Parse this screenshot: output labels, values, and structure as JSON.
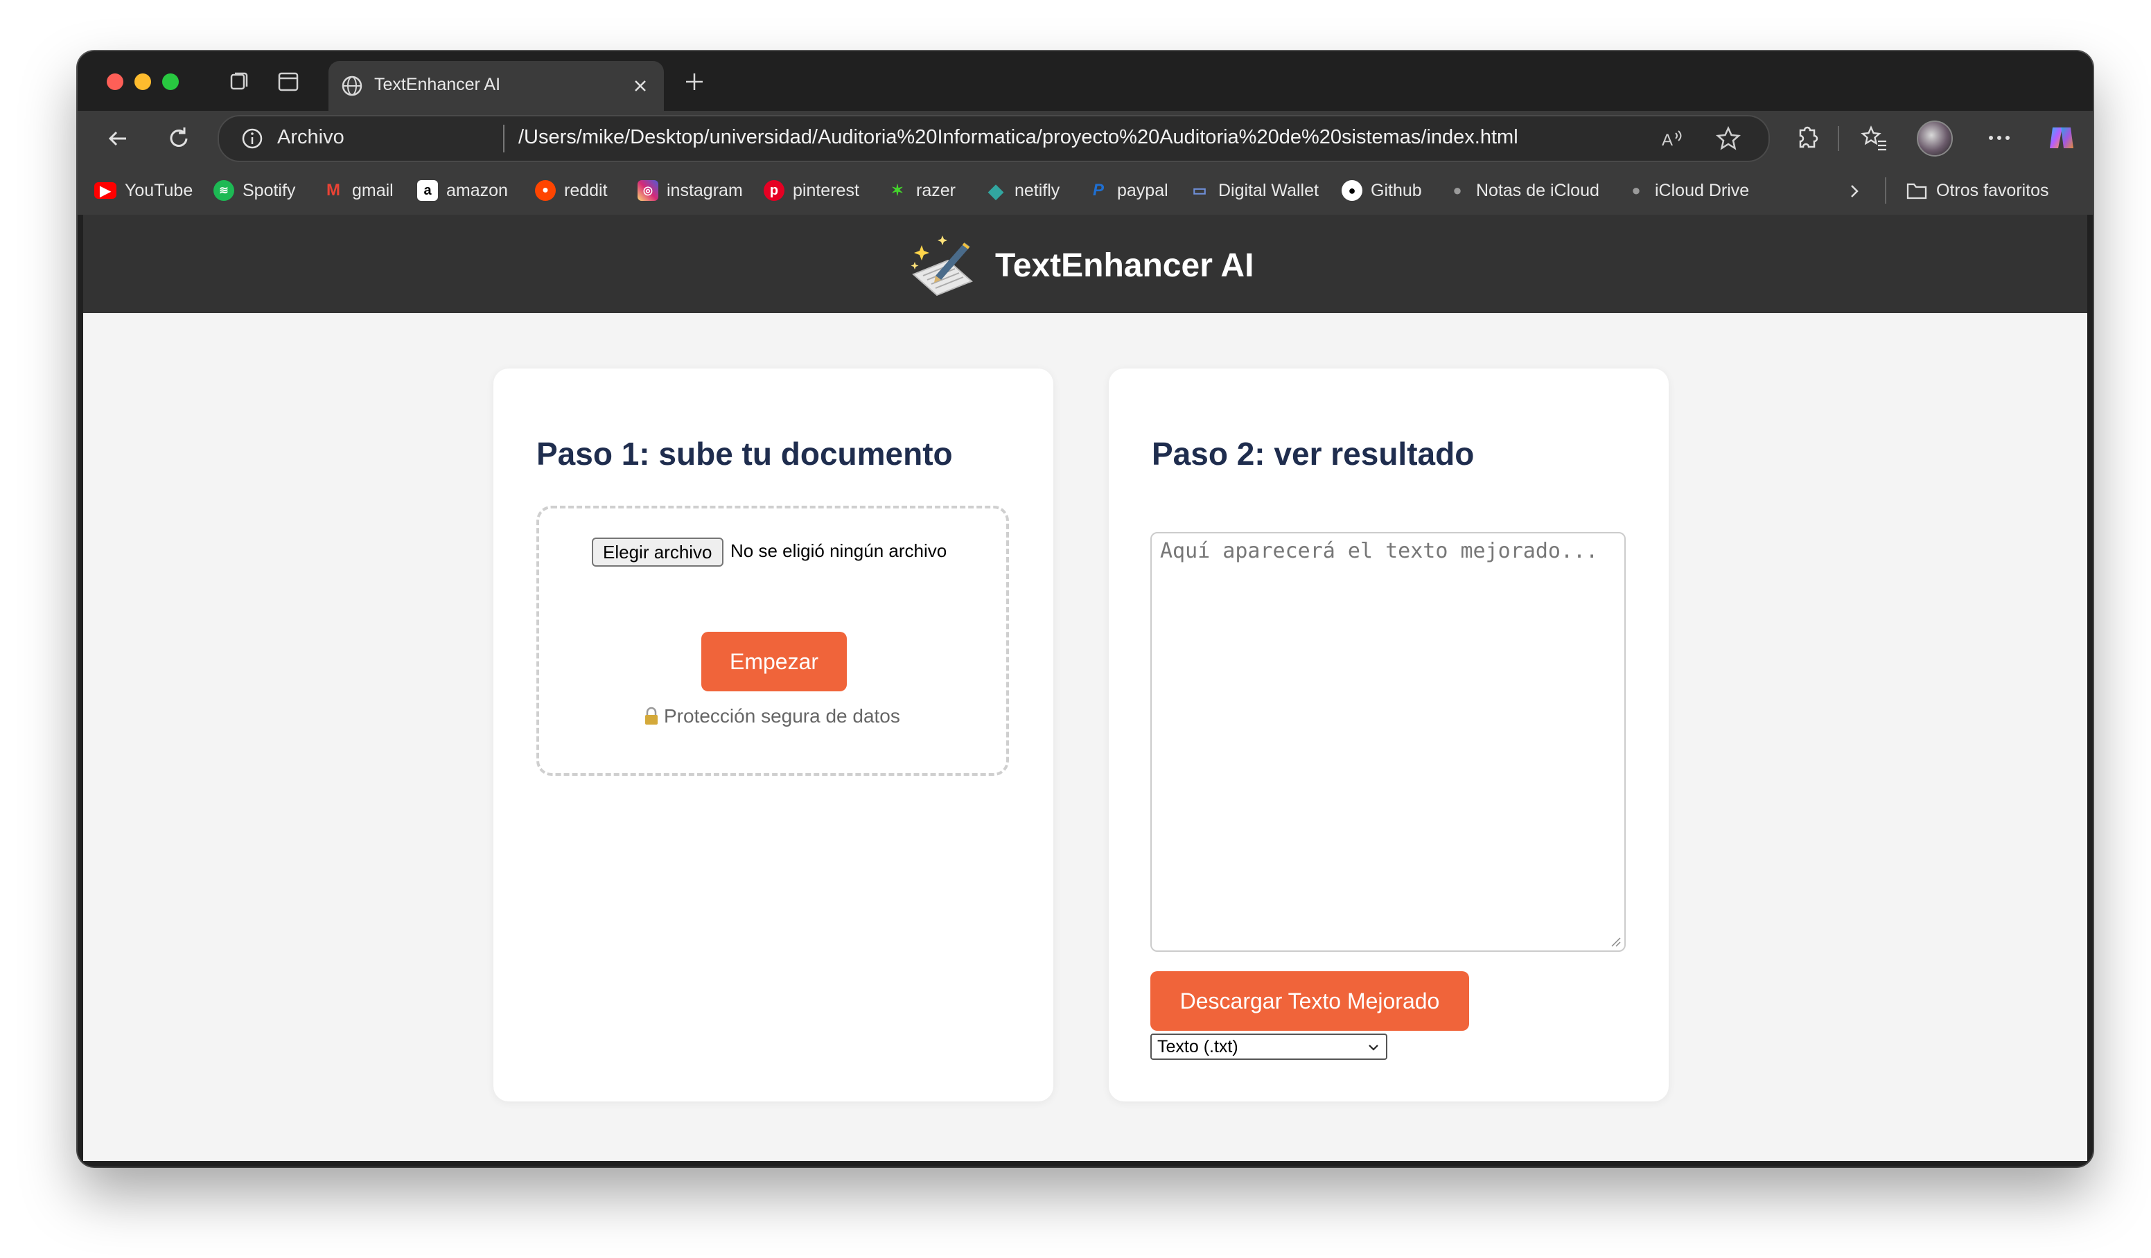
{
  "browser": {
    "tab_title": "TextEnhancer AI",
    "address_label": "Archivo",
    "url": "/Users/mike/Desktop/universidad/Auditoria%20Informatica/proyecto%20Auditoria%20de%20sistemas/index.html"
  },
  "bookmarks": [
    {
      "label": "YouTube",
      "icon": "youtube-icon",
      "color": "#ff0000"
    },
    {
      "label": "Spotify",
      "icon": "spotify-icon",
      "color": "#1db954"
    },
    {
      "label": "gmail",
      "icon": "gmail-icon",
      "color": "#ea4335"
    },
    {
      "label": "amazon",
      "icon": "amazon-icon",
      "color": "#ffffff"
    },
    {
      "label": "reddit",
      "icon": "reddit-icon",
      "color": "#ff4500"
    },
    {
      "label": "instagram",
      "icon": "instagram-icon",
      "color": "#d62976"
    },
    {
      "label": "pinterest",
      "icon": "pinterest-icon",
      "color": "#e60023"
    },
    {
      "label": "razer",
      "icon": "razer-icon",
      "color": "#44d62c"
    },
    {
      "label": "netifly",
      "icon": "netlify-icon",
      "color": "#32a6a0"
    },
    {
      "label": "paypal",
      "icon": "paypal-icon",
      "color": "#1f6fd1"
    },
    {
      "label": "Digital Wallet",
      "icon": "wallet-icon",
      "color": "#6f8fd8"
    },
    {
      "label": "Github",
      "icon": "github-icon",
      "color": "#ffffff"
    },
    {
      "label": "Notas de iCloud",
      "icon": "apple-icon",
      "color": "#9a9a9a"
    },
    {
      "label": "iCloud Drive",
      "icon": "apple-icon",
      "color": "#9a9a9a"
    }
  ],
  "other_favorites": "Otros favoritos",
  "app": {
    "title": "TextEnhancer AI",
    "step1": {
      "title": "Paso 1: sube tu documento",
      "file_button": "Elegir archivo",
      "file_status": "No se eligió ningún archivo",
      "start_button": "Empezar",
      "secure_note": "Protección segura de datos"
    },
    "step2": {
      "title": "Paso 2: ver resultado",
      "placeholder": "Aquí aparecerá el texto mejorado...",
      "download_button": "Descargar Texto Mejorado",
      "format_selected": "Texto (.txt)"
    }
  },
  "colors": {
    "accent": "#f0643a",
    "header_bg": "#333333",
    "heading": "#1f2d4e"
  }
}
